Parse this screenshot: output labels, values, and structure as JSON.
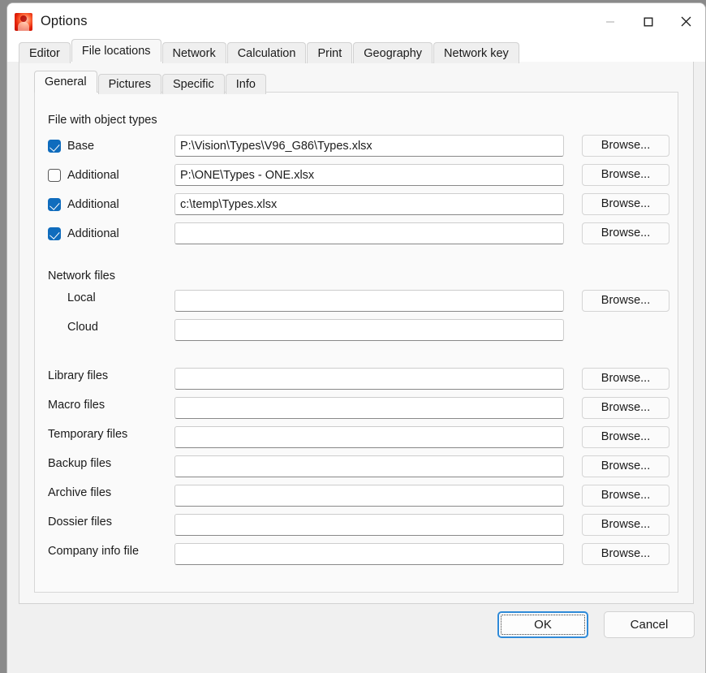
{
  "window": {
    "title": "Options",
    "icon": "app-icon",
    "controls": {
      "minimize": "minimize-icon",
      "maximize": "maximize-icon",
      "close": "close-icon"
    }
  },
  "outer_tabs": [
    {
      "label": "Editor",
      "active": false
    },
    {
      "label": "File locations",
      "active": true
    },
    {
      "label": "Network",
      "active": false
    },
    {
      "label": "Calculation",
      "active": false
    },
    {
      "label": "Print",
      "active": false
    },
    {
      "label": "Geography",
      "active": false
    },
    {
      "label": "Network key",
      "active": false
    }
  ],
  "inner_tabs": [
    {
      "label": "General",
      "active": true
    },
    {
      "label": "Pictures",
      "active": false
    },
    {
      "label": "Specific",
      "active": false
    },
    {
      "label": "Info",
      "active": false
    }
  ],
  "sections": {
    "object_types": {
      "title": "File with object types",
      "rows": [
        {
          "label": "Base",
          "checked": true,
          "value": "P:\\Vision\\Types\\V96_G86\\Types.xlsx",
          "browse": "Browse..."
        },
        {
          "label": "Additional",
          "checked": false,
          "value": "P:\\ONE\\Types - ONE.xlsx",
          "browse": "Browse..."
        },
        {
          "label": "Additional",
          "checked": true,
          "value": "c:\\temp\\Types.xlsx",
          "browse": "Browse..."
        },
        {
          "label": "Additional",
          "checked": true,
          "value": "",
          "browse": "Browse..."
        }
      ]
    },
    "network_files": {
      "title": "Network files",
      "rows": [
        {
          "label": "Local",
          "value": "",
          "browse": "Browse...",
          "has_browse": true
        },
        {
          "label": "Cloud",
          "value": "",
          "browse": "",
          "has_browse": false
        }
      ]
    },
    "other_files": {
      "rows": [
        {
          "label": "Library files",
          "value": "",
          "browse": "Browse..."
        },
        {
          "label": "Macro files",
          "value": "",
          "browse": "Browse..."
        },
        {
          "label": "Temporary files",
          "value": "",
          "browse": "Browse..."
        },
        {
          "label": "Backup files",
          "value": "",
          "browse": "Browse..."
        },
        {
          "label": "Archive files",
          "value": "",
          "browse": "Browse..."
        },
        {
          "label": "Dossier files",
          "value": "",
          "browse": "Browse..."
        },
        {
          "label": "Company info file",
          "value": "",
          "browse": "Browse..."
        }
      ]
    }
  },
  "footer": {
    "ok_label": "OK",
    "cancel_label": "Cancel"
  },
  "colors": {
    "accent": "#0f6cbd",
    "focus_border": "#2f8ad8",
    "titlebar_bg": "#ffffff",
    "dialog_bg": "#f0f0f0",
    "panel_bg": "#f7f7f7",
    "inner_panel_bg": "#fafafa",
    "text": "#1b1b1b",
    "input_bg": "#ffffff",
    "input_underline": "#898989"
  }
}
